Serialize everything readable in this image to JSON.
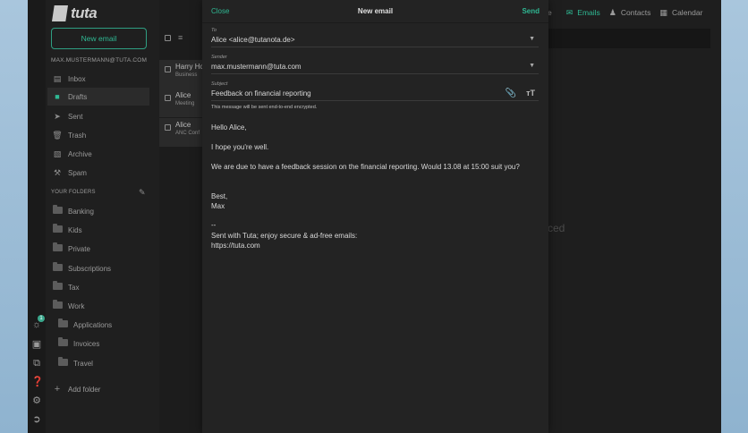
{
  "brand": {
    "name": "tuta"
  },
  "sidebar": {
    "new_email_label": "New email",
    "account": "MAX.MUSTERMANN@TUTA.COM",
    "system_folders": [
      {
        "label": "Inbox",
        "icon": "inbox-icon"
      },
      {
        "label": "Drafts",
        "icon": "drafts-icon",
        "active": true
      },
      {
        "label": "Sent",
        "icon": "sent-icon"
      },
      {
        "label": "Trash",
        "icon": "trash-icon"
      },
      {
        "label": "Archive",
        "icon": "archive-icon"
      },
      {
        "label": "Spam",
        "icon": "spam-icon"
      }
    ],
    "your_folders_heading": "YOUR FOLDERS",
    "folders": [
      {
        "label": "Banking"
      },
      {
        "label": "Kids"
      },
      {
        "label": "Private"
      },
      {
        "label": "Subscriptions"
      },
      {
        "label": "Tax"
      },
      {
        "label": "Work"
      },
      {
        "label": "Applications"
      },
      {
        "label": "Invoices"
      },
      {
        "label": "Travel"
      }
    ],
    "add_folder_label": "Add folder"
  },
  "rail": {
    "badge_count": "1"
  },
  "mail_list": {
    "rows": [
      {
        "from": "Harry Hc",
        "subject": "Business"
      },
      {
        "from": "Alice",
        "subject": "Meeting"
      },
      {
        "from": "Alice",
        "subject": "ANC Conf"
      }
    ]
  },
  "topbar": {
    "partial_left": "e",
    "tabs": [
      {
        "label": "Emails",
        "icon": "mail-icon",
        "active": true
      },
      {
        "label": "Contacts",
        "icon": "contacts-icon"
      },
      {
        "label": "Calendar",
        "icon": "calendar-icon"
      }
    ]
  },
  "background_hint": "ced",
  "composer": {
    "close_label": "Close",
    "title": "New email",
    "send_label": "Send",
    "to_label": "To",
    "to_value": "Alice <alice@tutanota.de>",
    "sender_label": "Sender",
    "sender_value": "max.mustermann@tuta.com",
    "subject_label": "Subject",
    "subject_value": "Feedback on financial reporting",
    "encryption_note": "This message will be sent end-to-end encrypted.",
    "body_lines": [
      "Hello Alice,",
      "I hope you're well.",
      "We are due to have a feedback session on the financial reporting. Would 13.08 at 15:00 suit you?",
      "Best,",
      "Max",
      "--",
      "Sent with Tuta; enjoy secure & ad-free emails:",
      "https://tuta.com"
    ]
  },
  "colors": {
    "accent": "#2fb893",
    "panel": "#232323",
    "background": "#1e1e1e"
  }
}
